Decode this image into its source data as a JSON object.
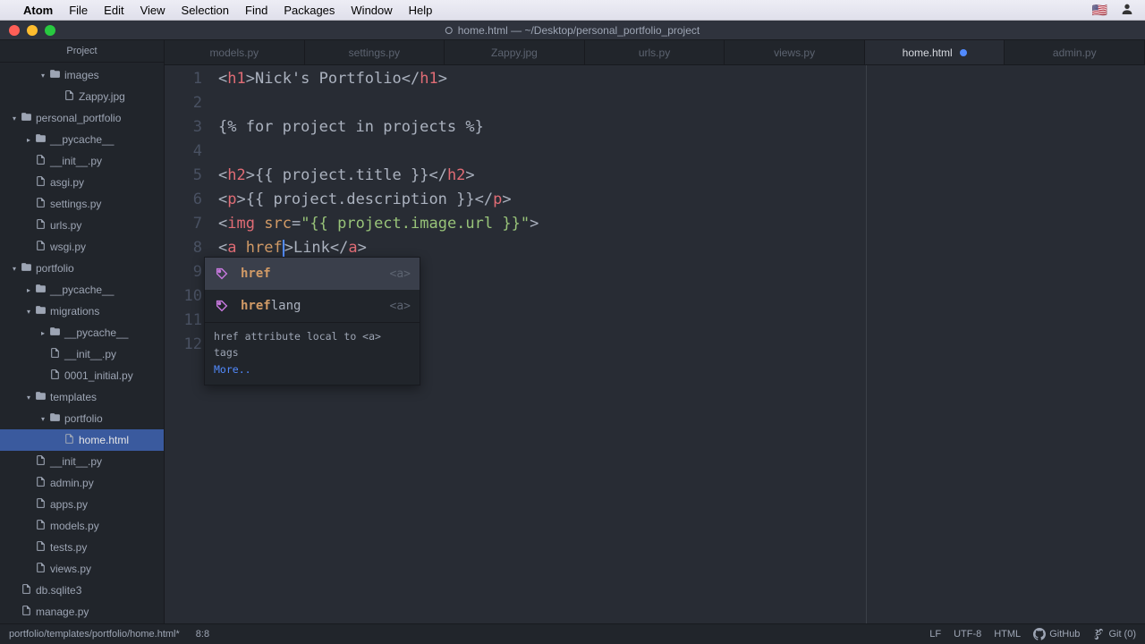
{
  "menubar": {
    "app": "Atom",
    "items": [
      "File",
      "Edit",
      "View",
      "Selection",
      "Find",
      "Packages",
      "Window",
      "Help"
    ]
  },
  "window": {
    "title": "home.html — ~/Desktop/personal_portfolio_project"
  },
  "sidebar": {
    "header": "Project",
    "tree": [
      {
        "depth": 2,
        "type": "folder",
        "open": true,
        "label": "images"
      },
      {
        "depth": 3,
        "type": "file",
        "label": "Zappy.jpg"
      },
      {
        "depth": 0,
        "type": "folder",
        "open": true,
        "label": "personal_portfolio"
      },
      {
        "depth": 1,
        "type": "folder",
        "open": false,
        "label": "__pycache__"
      },
      {
        "depth": 1,
        "type": "file",
        "label": "__init__.py"
      },
      {
        "depth": 1,
        "type": "file",
        "label": "asgi.py"
      },
      {
        "depth": 1,
        "type": "file",
        "label": "settings.py"
      },
      {
        "depth": 1,
        "type": "file",
        "label": "urls.py"
      },
      {
        "depth": 1,
        "type": "file",
        "label": "wsgi.py"
      },
      {
        "depth": 0,
        "type": "folder",
        "open": true,
        "label": "portfolio"
      },
      {
        "depth": 1,
        "type": "folder",
        "open": false,
        "label": "__pycache__"
      },
      {
        "depth": 1,
        "type": "folder",
        "open": true,
        "label": "migrations"
      },
      {
        "depth": 2,
        "type": "folder",
        "open": false,
        "label": "__pycache__"
      },
      {
        "depth": 2,
        "type": "file",
        "label": "__init__.py"
      },
      {
        "depth": 2,
        "type": "file",
        "label": "0001_initial.py"
      },
      {
        "depth": 1,
        "type": "folder",
        "open": true,
        "label": "templates"
      },
      {
        "depth": 2,
        "type": "folder",
        "open": true,
        "label": "portfolio"
      },
      {
        "depth": 3,
        "type": "file",
        "label": "home.html",
        "selected": true
      },
      {
        "depth": 1,
        "type": "file",
        "label": "__init__.py"
      },
      {
        "depth": 1,
        "type": "file",
        "label": "admin.py"
      },
      {
        "depth": 1,
        "type": "file",
        "label": "apps.py"
      },
      {
        "depth": 1,
        "type": "file",
        "label": "models.py"
      },
      {
        "depth": 1,
        "type": "file",
        "label": "tests.py"
      },
      {
        "depth": 1,
        "type": "file",
        "label": "views.py"
      },
      {
        "depth": 0,
        "type": "file",
        "label": "db.sqlite3"
      },
      {
        "depth": 0,
        "type": "file",
        "label": "manage.py"
      }
    ]
  },
  "tabs": [
    {
      "label": "models.py"
    },
    {
      "label": "settings.py"
    },
    {
      "label": "Zappy.jpg"
    },
    {
      "label": "urls.py"
    },
    {
      "label": "views.py"
    },
    {
      "label": "home.html",
      "active": true,
      "modified": true
    },
    {
      "label": "admin.py"
    }
  ],
  "code": {
    "lines": 12,
    "l1": {
      "t1": "<",
      "tag": "h1",
      "t2": ">",
      "txt": "Nick's Portfolio",
      "t3": "</",
      "tagc": "h1",
      "t4": ">"
    },
    "l3": "{% for project in projects %}",
    "l5": {
      "tag": "h2",
      "expr": "{{ project.title }}"
    },
    "l6": {
      "tag": "p",
      "expr": "{{ project.description }}"
    },
    "l7": {
      "tag": "img",
      "attr": "src",
      "val": "\"{{ project.image.url }}\""
    },
    "l8": {
      "tag": "a",
      "attr": "href",
      "txt": "Link"
    }
  },
  "autocomplete": {
    "items": [
      {
        "match": "href",
        "rest": "",
        "hint": "<a>",
        "selected": true
      },
      {
        "match": "href",
        "rest": "lang",
        "hint": "<a>"
      }
    ],
    "footer": "href attribute local to <a> tags",
    "more": "More.."
  },
  "statusbar": {
    "path": "portfolio/templates/portfolio/home.html*",
    "cursor": "8:8",
    "eol": "LF",
    "encoding": "UTF-8",
    "lang": "HTML",
    "github": "GitHub",
    "git": "Git (0)"
  }
}
